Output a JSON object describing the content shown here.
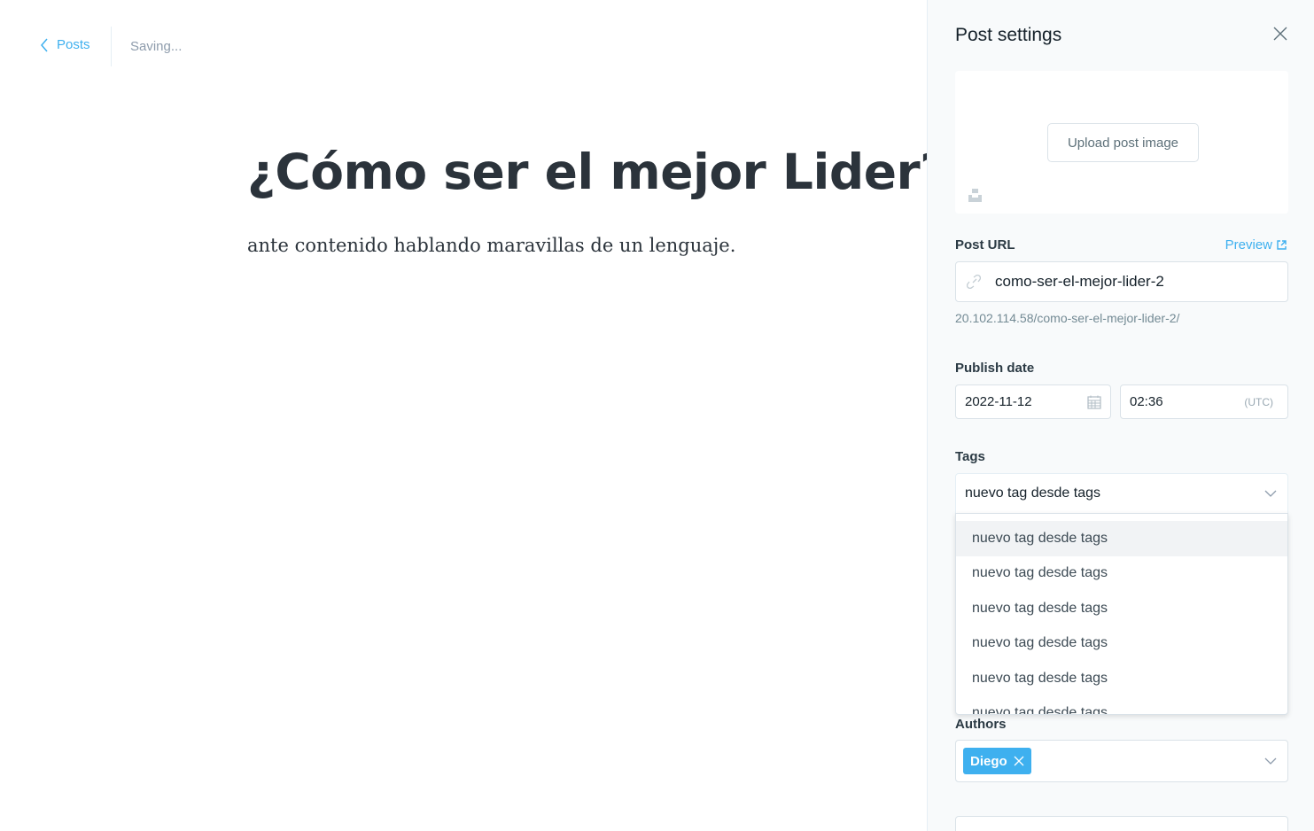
{
  "header": {
    "back_label": "Posts",
    "status": "Saving..."
  },
  "post": {
    "title": "¿Cómo ser el mejor Lider?",
    "body": "ante contenido hablando maravillas de un lenguaje."
  },
  "settings": {
    "title": "Post settings",
    "upload_label": "Upload post image",
    "url_label": "Post URL",
    "preview_label": "Preview",
    "slug": "como-ser-el-mejor-lider-2",
    "full_url": "20.102.114.58/como-ser-el-mejor-lider-2/",
    "publish_label": "Publish date",
    "date": "2022-11-12",
    "time": "02:36",
    "timezone": "(UTC)",
    "tags_label": "Tags",
    "tags_input": "nuevo tag desde tags",
    "tag_options": [
      "nuevo tag desde tags",
      "nuevo tag desde tags",
      "nuevo tag desde tags",
      "nuevo tag desde tags",
      "nuevo tag desde tags",
      "nuevo tag desde tags"
    ],
    "authors_label": "Authors",
    "author": "Diego"
  },
  "colors": {
    "accent": "#3eb0ef",
    "panel_bg": "#f8fafb",
    "text_dark": "#2b333b"
  },
  "icons": [
    "chevron-left-icon",
    "close-icon",
    "unsplash-icon",
    "link-icon",
    "external-link-icon",
    "calendar-icon",
    "chevron-down-icon",
    "remove-author-icon"
  ]
}
